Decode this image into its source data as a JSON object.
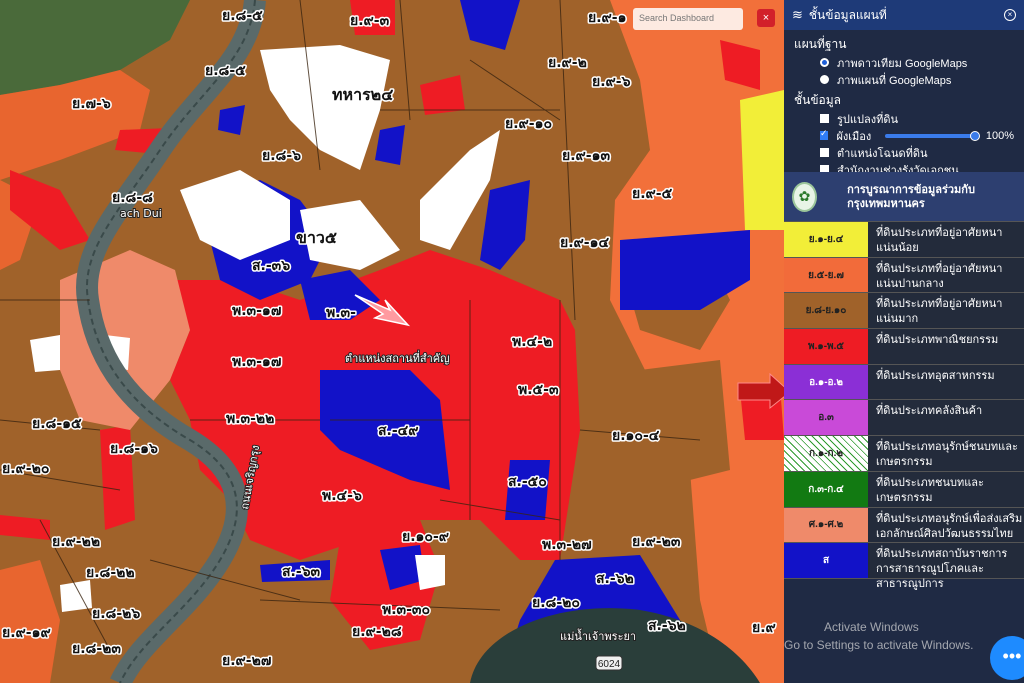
{
  "panel": {
    "title": "ชั้นข้อมูลแผนที่",
    "basemap_title": "แผนที่ฐาน",
    "basemap_options": [
      "ภาพดาวเทียม GoogleMaps",
      "ภาพแผนที่ GoogleMaps"
    ],
    "layers_title": "ชั้นข้อมูล",
    "layers": [
      "รูปแปลงที่ดิน",
      "ผังเมือง",
      "ตำแหน่งโฉนดที่ดิน",
      "สำนักงานช่างรังวัดเอกชน"
    ],
    "opacity": "100%",
    "layer_checked": [
      false,
      true,
      false,
      false
    ]
  },
  "legend": {
    "header": "การบูรณาการข้อมูลร่วมกับ กรุงเทพมหานคร",
    "rows": [
      {
        "code": "ย.๑-ย.๔",
        "desc": "ที่ดินประเภทที่อยู่อาศัยหนาแน่นน้อย",
        "color": "#f2ee38"
      },
      {
        "code": "ย.๕-ย.๗",
        "desc": "ที่ดินประเภทที่อยู่อาศัยหนาแน่นปานกลาง",
        "color": "#f26b3a"
      },
      {
        "code": "ย.๘-ย.๑๐",
        "desc": "ที่ดินประเภทที่อยู่อาศัยหนาแน่นมาก",
        "color": "#a0622a"
      },
      {
        "code": "พ.๑-พ.๕",
        "desc": "ที่ดินประเภทพาณิชยกรรม",
        "color": "#ee1c24"
      },
      {
        "code": "อ.๑-อ.๒",
        "desc": "ที่ดินประเภทอุตสาหกรรม",
        "color": "#8b2fd6"
      },
      {
        "code": "อ.๓",
        "desc": "ที่ดินประเภทคลังสินค้า",
        "color": "#c94ad8"
      },
      {
        "code": "ก.๑-ก.๒",
        "desc": "ที่ดินประเภทอนุรักษ์ชนบทและเกษตรกรรม",
        "color": "#ffffff"
      },
      {
        "code": "ก.๓-ก.๔",
        "desc": "ที่ดินประเภทชนบทและเกษตรกรรม",
        "color": "#127a12"
      },
      {
        "code": "ศ.๑-ศ.๒",
        "desc": "ที่ดินประเภทอนุรักษ์เพื่อส่งเสริมเอกลักษณ์ศิลปวัฒนธรรมไทย",
        "color": "#ef8a6a"
      },
      {
        "code": "ส",
        "desc": "ที่ดินประเภทสถาบันราชการ การสาธารณูปโภคและสาธารณูปการ",
        "color": "#1212c8"
      }
    ]
  },
  "map": {
    "search_placeholder": "Search Dashboard",
    "close_label": "×",
    "landmark": "ตำแหน่งสถานที่สำคัญ",
    "road_label": "6024",
    "place_partial": "แม่น้ำเจ้าพระยา",
    "place_edge": "ach Dui",
    "river_text": "ถนนเจริญกรุง",
    "labels": [
      {
        "t": "ย.๘-๕",
        "big": false
      },
      {
        "t": "ย.๙-๓",
        "big": false
      },
      {
        "t": "ย.๙-๑",
        "big": false
      },
      {
        "t": "ย.๘-๕",
        "big": false
      },
      {
        "t": "ย.๙-๒",
        "big": false
      },
      {
        "t": "ย.๙-๖",
        "big": false
      },
      {
        "t": "ทหาร๒๔",
        "big": true
      },
      {
        "t": "ย.๗-๖",
        "big": false
      },
      {
        "t": "ย.๙-๑๐",
        "big": false
      },
      {
        "t": "ย.๘-๖",
        "big": false
      },
      {
        "t": "ย.๙-๑๓",
        "big": false
      },
      {
        "t": "ย.๘-๘",
        "big": false
      },
      {
        "t": "ย.๙-๕",
        "big": false
      },
      {
        "t": "ขาว๕",
        "big": true
      },
      {
        "t": "ย.๙-๑๔",
        "big": false
      },
      {
        "t": "ส.-๓๖",
        "big": false
      },
      {
        "t": "พ.๓-๑๗",
        "big": false
      },
      {
        "t": "พ.๓-",
        "big": false
      },
      {
        "t": "พ.๔-๒",
        "big": false
      },
      {
        "t": "พ.๓-๑๗",
        "big": false
      },
      {
        "t": "พ.๕-๓",
        "big": false
      },
      {
        "t": "ย.๘-๑๕",
        "big": false
      },
      {
        "t": "พ.๓-๒๒",
        "big": false
      },
      {
        "t": "ส.-๔๙",
        "big": false
      },
      {
        "t": "ย.๘-๑๖",
        "big": false
      },
      {
        "t": "ย.๑๐-๔",
        "big": false
      },
      {
        "t": "ย.๙-๒๐",
        "big": false
      },
      {
        "t": "พ.๔-๖",
        "big": false
      },
      {
        "t": "ส.-๕๐",
        "big": false
      },
      {
        "t": "ย.๑๐-๙",
        "big": false
      },
      {
        "t": "ย.๙-๒๒",
        "big": false
      },
      {
        "t": "พ.๓-๒๗",
        "big": false
      },
      {
        "t": "ย.๙-๒๓",
        "big": false
      },
      {
        "t": "ย.๘-๒๒",
        "big": false
      },
      {
        "t": "ส.-๖๓",
        "big": false
      },
      {
        "t": "ส.-๖๒",
        "big": false
      },
      {
        "t": "ย.๘-๒๖",
        "big": false
      },
      {
        "t": "พ.๓-๓๐",
        "big": false
      },
      {
        "t": "ย.๘-๒๐",
        "big": false
      },
      {
        "t": "ย.๙-๑๙",
        "big": false
      },
      {
        "t": "ย.๙-๒๘",
        "big": false
      },
      {
        "t": "ส.-๖๒",
        "big": false
      },
      {
        "t": "ย.๘-๒๓",
        "big": false
      },
      {
        "t": "ย.๙-๒๗",
        "big": false
      },
      {
        "t": "ย.๙",
        "big": false
      }
    ]
  },
  "watermark": {
    "line1": "Activate Windows",
    "line2": "Go to Settings to activate Windows."
  },
  "chat_icon": "chat-bubble-icon"
}
